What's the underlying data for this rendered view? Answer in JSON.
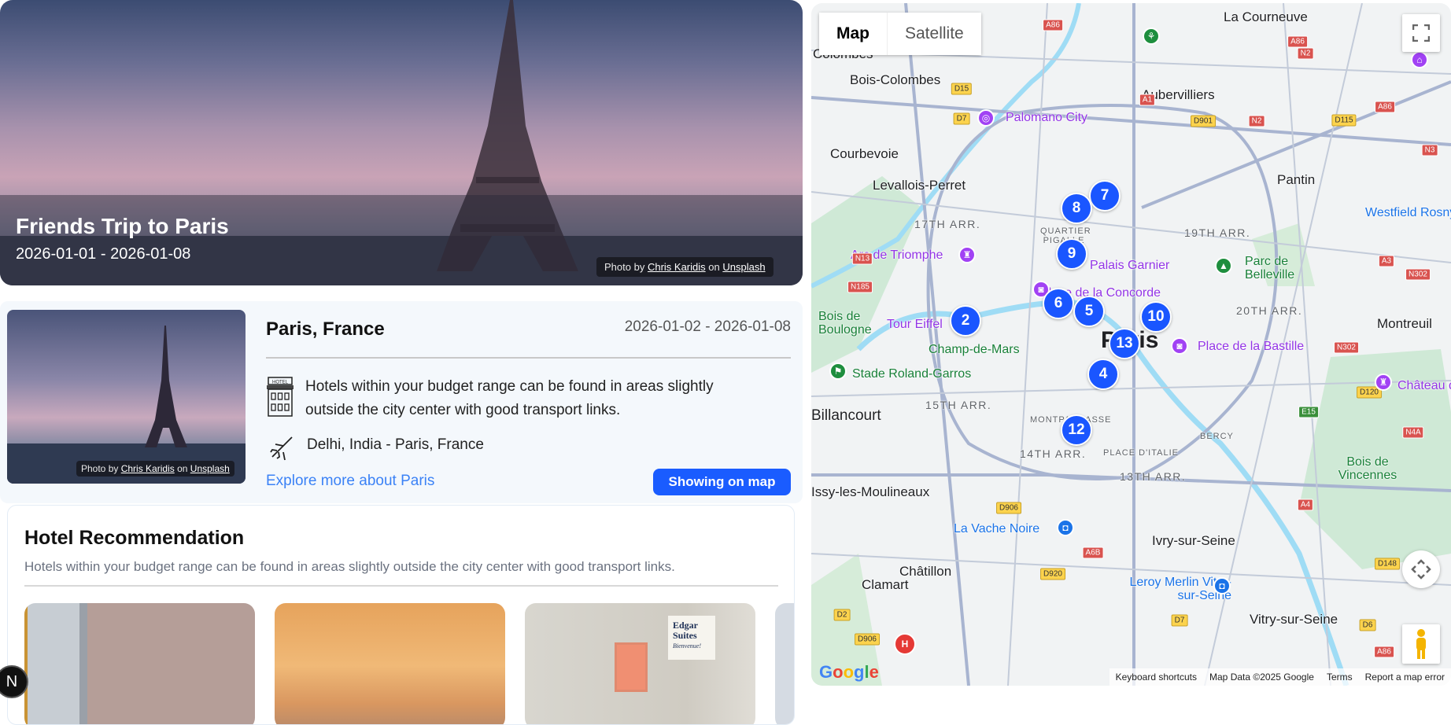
{
  "hero": {
    "title": "Friends Trip to Paris",
    "dates": "2026-01-01 - 2026-01-08",
    "credit": {
      "prefix": "Photo by",
      "author": "Chris Karidis",
      "on": "on",
      "site": "Unsplash"
    }
  },
  "destination": {
    "title": "Paris, France",
    "dates": "2026-01-02 - 2026-01-08",
    "hotel_note": "Hotels within your budget range can be found in areas slightly outside the city center with good transport links.",
    "hotel_icon_text": "HOTEL",
    "route": "Delhi, India - Paris, France",
    "explore_link": "Explore more about Paris",
    "map_button": "Showing on map",
    "credit": {
      "prefix": "Photo by",
      "author": "Chris Karidis",
      "on": "on",
      "site": "Unsplash"
    }
  },
  "hotels": {
    "title": "Hotel Recommendation",
    "subtitle": "Hotels within your budget range can be found in areas slightly outside the city center with good transport links.",
    "card3_sign": [
      "Edgar",
      "Suites",
      "Bienvenue!"
    ]
  },
  "badge": "N",
  "map": {
    "tabs": [
      "Map",
      "Satellite"
    ],
    "labels": [
      "La Courneuve",
      "Colombes",
      "Bois-Colombes",
      "Aubervilliers",
      "Palomano City",
      "Courbevoie",
      "Pantin",
      "Levallois-Perret",
      "17TH ARR.",
      "19TH ARR.",
      "Westfield Rosny",
      "Arc de Triomphe",
      "Palais Garnier",
      "Parc de Belleville",
      "Place de la Concorde",
      "20TH ARR.",
      "Montreuil",
      "Bois de Boulogne",
      "Tour Eiffel",
      "Paris",
      "Champ-de-Mars",
      "Place de la Bastille",
      "Stade Roland-Garros",
      "15TH ARR.",
      "Billancourt",
      "MONTPARNASSE",
      "14TH ARR.",
      "PLACE D'ITALIE",
      "BERCY",
      "13TH ARR.",
      "Bois de Vincennes",
      "Issy-les-Moulineaux",
      "La Vache Noire",
      "Ivry-sur-Seine",
      "Châtillon",
      "Clamart",
      "Leroy Merlin Vitry-sur-Seine",
      "Vitry-sur-Seine",
      "QUARTIER PIGALLE",
      "Château de"
    ],
    "shields": [
      "A86",
      "A86",
      "N2",
      "A1",
      "D15",
      "D7",
      "D901",
      "N2",
      "D115",
      "A86",
      "N3",
      "N13",
      "N185",
      "A3",
      "N302",
      "N302",
      "D120",
      "E15",
      "N4A",
      "D906",
      "A6B",
      "D920",
      "D148",
      "D2",
      "D906",
      "D7",
      "D6",
      "A86",
      "A4"
    ],
    "markers": [
      "7",
      "8",
      "9",
      "6",
      "5",
      "2",
      "10",
      "13",
      "4",
      "12"
    ],
    "footer": [
      "Keyboard shortcuts",
      "Map Data ©2025 Google",
      "Terms",
      "Report a map error"
    ],
    "logo": "Google"
  }
}
